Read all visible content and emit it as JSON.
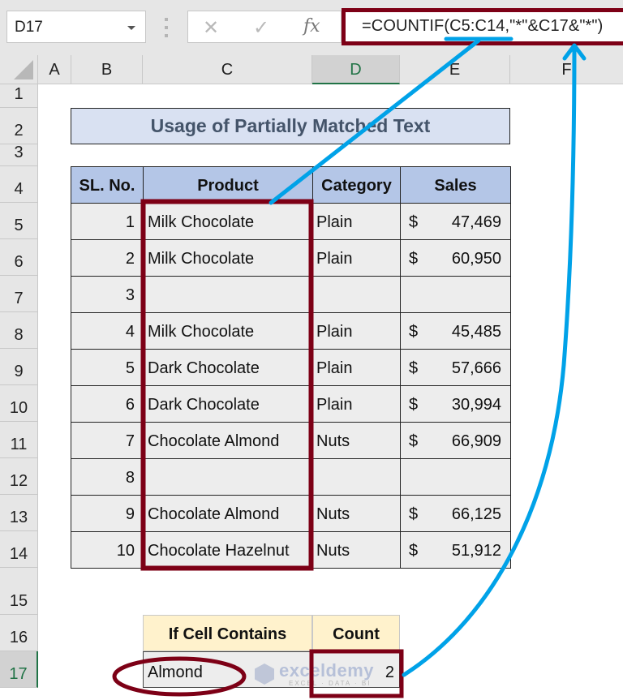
{
  "formula_bar": {
    "name_box": "D17",
    "cancel_icon": "✕",
    "enter_icon": "✓",
    "fx_label": "fx",
    "formula": "=COUNTIF(C5:C14,\"*\"&C17&\"*\")"
  },
  "columns": [
    "A",
    "B",
    "C",
    "D",
    "E",
    "F"
  ],
  "selected_column": "D",
  "rows": [
    "1",
    "2",
    "3",
    "4",
    "5",
    "6",
    "7",
    "8",
    "9",
    "10",
    "11",
    "12",
    "13",
    "14",
    "15",
    "16",
    "17"
  ],
  "selected_row": "17",
  "title": "Usage of Partially Matched Text",
  "table": {
    "headers": [
      "SL. No.",
      "Product",
      "Category",
      "Sales"
    ],
    "rows": [
      {
        "sl": "1",
        "product": "Milk Chocolate",
        "category": "Plain",
        "currency": "$",
        "sales": "47,469"
      },
      {
        "sl": "2",
        "product": "Milk Chocolate",
        "category": "Plain",
        "currency": "$",
        "sales": "60,950"
      },
      {
        "sl": "3",
        "product": "",
        "category": "",
        "currency": "",
        "sales": ""
      },
      {
        "sl": "4",
        "product": "Milk Chocolate",
        "category": "Plain",
        "currency": "$",
        "sales": "45,485"
      },
      {
        "sl": "5",
        "product": "Dark Chocolate",
        "category": "Plain",
        "currency": "$",
        "sales": "57,666"
      },
      {
        "sl": "6",
        "product": "Dark Chocolate",
        "category": "Plain",
        "currency": "$",
        "sales": "30,994"
      },
      {
        "sl": "7",
        "product": "Chocolate Almond",
        "category": "Nuts",
        "currency": "$",
        "sales": "66,909"
      },
      {
        "sl": "8",
        "product": "",
        "category": "",
        "currency": "",
        "sales": ""
      },
      {
        "sl": "9",
        "product": "Chocolate Almond",
        "category": "Nuts",
        "currency": "$",
        "sales": "66,125"
      },
      {
        "sl": "10",
        "product": "Chocolate Hazelnut",
        "category": "Nuts",
        "currency": "$",
        "sales": "51,912"
      }
    ]
  },
  "lookup": {
    "headers": [
      "If Cell Contains",
      "Count"
    ],
    "criteria": "Almond",
    "count": "2"
  },
  "watermark": {
    "brand": "exceldemy",
    "tagline": "EXCEL · DATA · BI"
  },
  "colors": {
    "highlight": "#7d0016",
    "arrow": "#00a2e8",
    "title_bg": "#d9e1f2",
    "header_bg": "#b4c6e7",
    "lookup_header_bg": "#fff2cc",
    "excel_green": "#217346"
  }
}
